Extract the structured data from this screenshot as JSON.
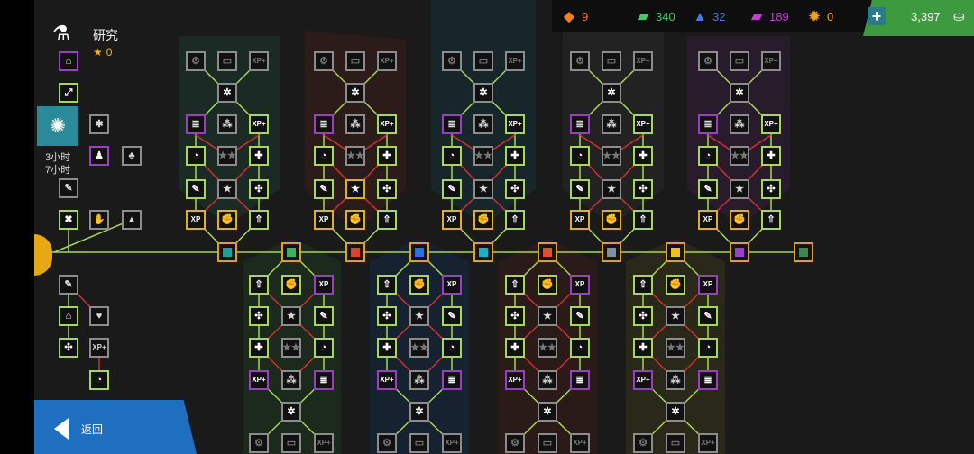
{
  "header": {
    "title": "研究",
    "stars": "0",
    "star_icon": "star-icon",
    "title_icon": "flask-icon"
  },
  "resources": [
    {
      "icon": "crate-icon",
      "value": "9",
      "color": "#f08020"
    },
    {
      "icon": "green-chip-icon",
      "value": "340",
      "color": "#4cc46a"
    },
    {
      "icon": "blue-chip-icon",
      "value": "32",
      "color": "#4a78e0"
    },
    {
      "icon": "purple-chip-icon",
      "value": "189",
      "color": "#c040d0"
    },
    {
      "icon": "orange-gear-icon",
      "value": "0",
      "color": "#f0a020"
    }
  ],
  "currency": {
    "value": "3,397",
    "icon": "cash-icon",
    "add_icon": "plus-icon"
  },
  "timer": {
    "line1": "3小时",
    "line2": "7小时"
  },
  "footer": {
    "back_label": "返回"
  },
  "colors": {
    "green_border": "#a6d65a",
    "purple_border": "#9b3fc1",
    "yellow_border": "#e0b020",
    "hub_border": "#e0a020",
    "line_green": "#a6d65a",
    "line_red": "#d03030"
  },
  "hubs": [
    {
      "icon": "teal-square-icon",
      "color": "#1aa0a0"
    },
    {
      "icon": "green-triangle-icon",
      "color": "#3ab060"
    },
    {
      "icon": "red-pentagon-icon",
      "color": "#e04030"
    },
    {
      "icon": "blue-circle-icon",
      "color": "#2a70e0"
    },
    {
      "icon": "cyan-hexagon-icon",
      "color": "#1ab0d0"
    },
    {
      "icon": "red-hexagon-icon",
      "color": "#e05030"
    },
    {
      "icon": "grey-shield-icon",
      "color": "#8090a0"
    },
    {
      "icon": "yellow-triangle-icon",
      "color": "#f0c020"
    },
    {
      "icon": "purple-diamond-icon",
      "color": "#9a40d0"
    },
    {
      "icon": "green-chevron-icon",
      "color": "#3a8a50"
    }
  ]
}
